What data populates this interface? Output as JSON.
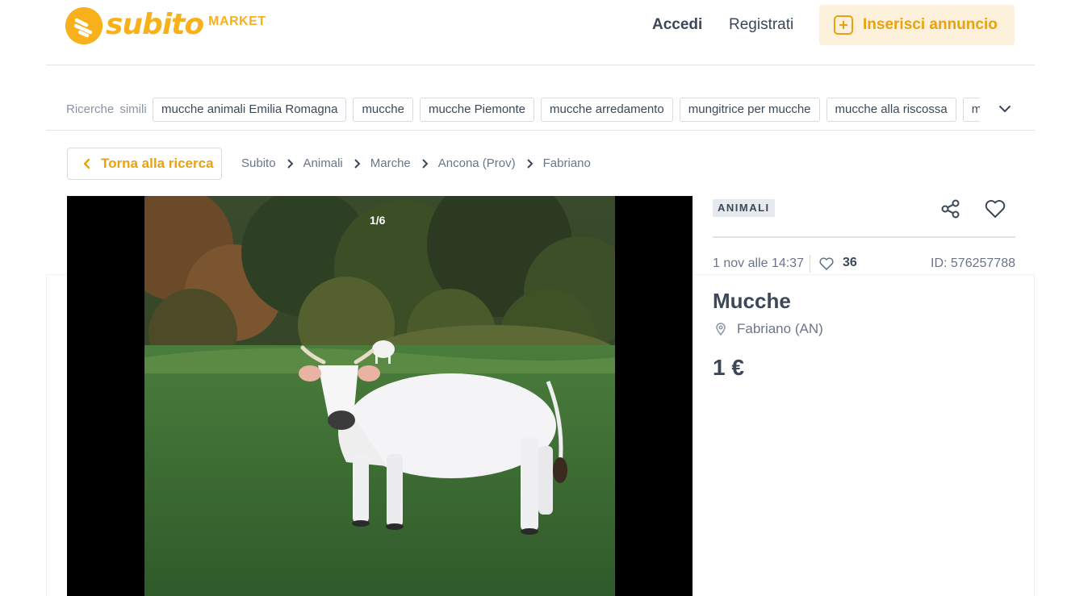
{
  "header": {
    "logo": {
      "word": "subito",
      "suffix": "MARKET"
    },
    "login_label": "Accedi",
    "register_label": "Registrati",
    "insert_label": "Inserisci annuncio"
  },
  "related": {
    "label": "Ricerche simili",
    "chips": [
      "mucche animali Emilia Romagna",
      "mucche",
      "mucche Piemonte",
      "mucche arredamento",
      "mungitrice per mucche",
      "mucche alla riscossa",
      "mucche"
    ]
  },
  "back_label": "Torna alla ricerca",
  "breadcrumb": [
    "Subito",
    "Animali",
    "Marche",
    "Ancona (Prov)",
    "Fabriano"
  ],
  "gallery": {
    "counter": "1/6"
  },
  "ad": {
    "category": "ANIMALI",
    "date": "1 nov alle 14:37",
    "likes": "36",
    "id": "ID: 576257788",
    "title": "Mucche",
    "location": "Fabriano (AN)",
    "price": "1 €"
  },
  "colors": {
    "brand": "#f9b11b",
    "accent_text": "#e8a20e",
    "text": "#3c4858",
    "muted": "#6b7588"
  },
  "icons": [
    "subito-logo-icon",
    "plus-square-icon",
    "chevron-down-icon",
    "chevron-left-icon",
    "chevron-right-icon",
    "share-icon",
    "heart-icon",
    "map-pin-icon"
  ]
}
